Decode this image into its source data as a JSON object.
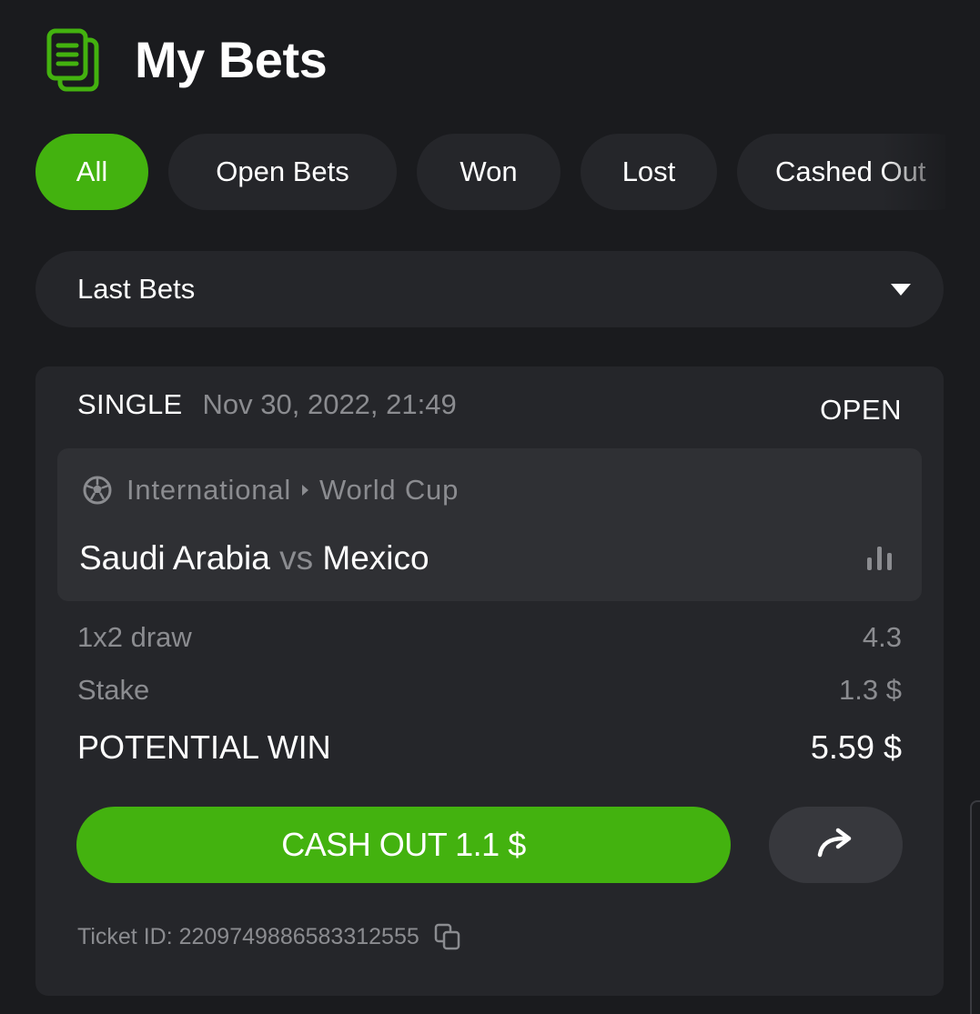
{
  "header": {
    "title": "My Bets",
    "icon": "bets-document-icon",
    "icon_color": "#43b20f"
  },
  "filters": [
    {
      "label": "All",
      "active": true
    },
    {
      "label": "Open Bets",
      "active": false
    },
    {
      "label": "Won",
      "active": false
    },
    {
      "label": "Lost",
      "active": false
    },
    {
      "label": "Cashed Out",
      "active": false
    }
  ],
  "dropdown": {
    "selected": "Last Bets"
  },
  "bet": {
    "type": "SINGLE",
    "date": "Nov 30, 2022, 21:49",
    "status": "OPEN",
    "league": {
      "country": "International",
      "competition": "World Cup"
    },
    "match": {
      "home": "Saudi Arabia",
      "vs": "vs",
      "away": "Mexico"
    },
    "market": {
      "label": "1x2 draw",
      "odds": "4.3"
    },
    "stake": {
      "label": "Stake",
      "value": "1.3 $"
    },
    "potential_win": {
      "label": "POTENTIAL WIN",
      "value": "5.59 $"
    },
    "cashout_label": "CASH OUT 1.1 $",
    "ticket_id": "Ticket ID: 2209749886583312555"
  },
  "colors": {
    "accent": "#43b20f",
    "background": "#1a1b1e",
    "card": "#25262a",
    "muted_text": "#8b8c90"
  }
}
